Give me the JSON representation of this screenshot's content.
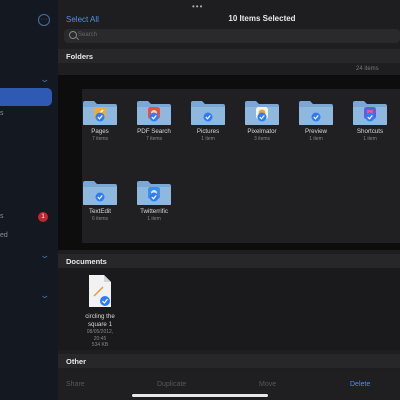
{
  "sidebar": {
    "more_icon": "ellipsis-circle-icon",
    "items": [
      {
        "label": "s"
      },
      {
        "label": "s"
      },
      {
        "label": "ed"
      }
    ],
    "badge": "1",
    "selected_color": "#2f5ab3"
  },
  "header": {
    "dots": "•••",
    "select_all": "Select All",
    "title": "10 Items Selected"
  },
  "search": {
    "placeholder": "Search"
  },
  "folders": {
    "heading": "Folders",
    "count": "24 items",
    "items": [
      {
        "name": "Pages",
        "count": "7 items",
        "icon": "pages-app-icon"
      },
      {
        "name": "PDF Search",
        "count": "7 items",
        "icon": "pdf-search-app-icon"
      },
      {
        "name": "Pictures",
        "count": "1 item",
        "icon": "folder-icon"
      },
      {
        "name": "Pixelmator",
        "count": "3 items",
        "icon": "pixelmator-app-icon"
      },
      {
        "name": "Preview",
        "count": "1 item",
        "icon": "folder-icon"
      },
      {
        "name": "Shortcuts",
        "count": "1 item",
        "icon": "shortcuts-app-icon"
      },
      {
        "name": "TextEdit",
        "count": "6 items",
        "icon": "folder-icon"
      },
      {
        "name": "Twitterrific",
        "count": "1 item",
        "icon": "twitterrific-app-icon"
      }
    ]
  },
  "documents": {
    "heading": "Documents",
    "items": [
      {
        "name_line1": "circling the",
        "name_line2": "square 1",
        "date": "08/05/2012, 20:45",
        "size": "534 KB"
      }
    ]
  },
  "other": {
    "heading": "Other"
  },
  "toolbar": {
    "share": "Share",
    "duplicate": "Duplicate",
    "move": "Move",
    "delete": "Delete"
  },
  "colors": {
    "accent": "#4d8ef7",
    "folder": "#8fb8de",
    "check": "#2f7bf5",
    "badge": "#c0262d"
  }
}
